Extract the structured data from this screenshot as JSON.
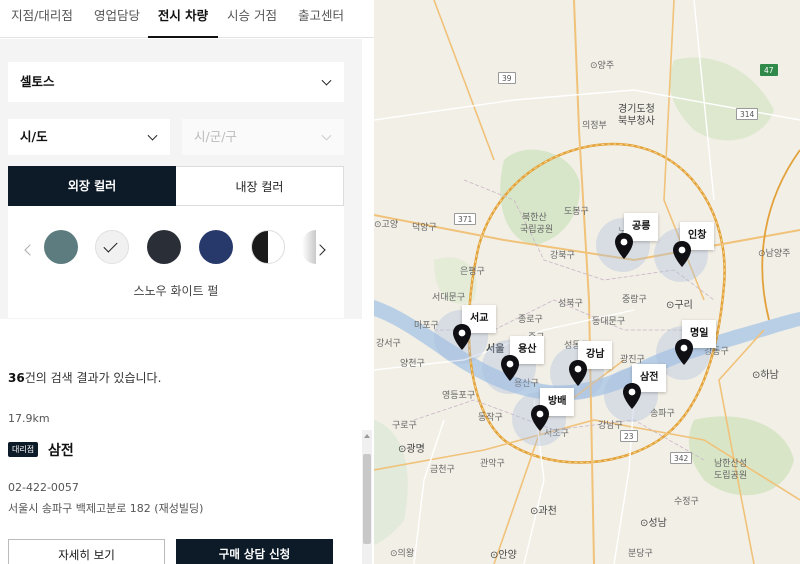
{
  "tabs": [
    {
      "label": "지점/대리점"
    },
    {
      "label": "영업담당"
    },
    {
      "label": "전시 차량"
    },
    {
      "label": "시승 거점"
    },
    {
      "label": "출고센터"
    }
  ],
  "filters": {
    "model": "셀토스",
    "province": "시/도",
    "district": "시/군/구"
  },
  "color_tabs": {
    "exterior": "외장 컬러",
    "interior": "내장 컬러"
  },
  "selected_color_name": "스노우 화이트 펄",
  "swatch_colors": [
    "#5d7c80",
    "#f1f1f1",
    "#2a2e36",
    "#27386b",
    "#1a1a1a",
    "#c9c9c9"
  ],
  "results": {
    "count": "36",
    "count_suffix": "건의 검색 결과가 있습니다."
  },
  "dealer": {
    "distance": "17.9km",
    "badge": "대리점",
    "name": "삼전",
    "phone": "02-422-0057",
    "address": "서울시 송파구 백제고분로 182 (재성빌딩)",
    "detail_button": "자세히 보기",
    "consult_button": "구매 상담 신청"
  },
  "map": {
    "pins": [
      {
        "label": "공릉"
      },
      {
        "label": "인창"
      },
      {
        "label": "서교"
      },
      {
        "label": "용산"
      },
      {
        "label": "강남"
      },
      {
        "label": "명일"
      },
      {
        "label": "삼전"
      },
      {
        "label": "방배"
      }
    ],
    "labels": {
      "yangju": "⊙양주",
      "uijeongbu": "의정부",
      "gyeonggi_north": "경기도청",
      "gyeonggi_north2": "북부청사",
      "dongducheon_road": "39",
      "goyang": "⊙고양",
      "deogyang": "덕양구",
      "bukhansan": "북한산",
      "bukhansan2": "국립공원",
      "dobong": "도봉구",
      "nowon": "노원구",
      "gangbuk": "강북구",
      "eunpyeong": "은평구",
      "seongbuk": "성북구",
      "jungnang": "중랑구",
      "guri": "⊙구리",
      "namyangju": "⊙남양주",
      "jongno": "종로구",
      "seodaemun": "서대문구",
      "mapo": "마포구",
      "jung": "중구",
      "dongdaemun": "동대문구",
      "seongdong": "성동구",
      "gwangjin": "광진구",
      "gangdong": "강동구",
      "hanam": "⊙하남",
      "yongsan": "용산구",
      "yeongdeungpo": "영등포구",
      "dongjak": "동작구",
      "seocho": "서초구",
      "gangnam": "강남구",
      "songpa": "송파구",
      "gwanak": "관악구",
      "guro": "구로구",
      "gwangmyeong": "⊙광명",
      "geumcheon": "금천구",
      "gwacheon": "⊙과천",
      "seongnam": "⊙성남",
      "sujeong": "수정구",
      "bundang": "분당구",
      "anyang": "⊙안양",
      "namhansan": "남한산성",
      "namhansan2": "도립공원",
      "yangcheon": "양천구",
      "gangseo": "강서구",
      "uiwang": "⊙의왕",
      "seoul": "서울"
    }
  }
}
